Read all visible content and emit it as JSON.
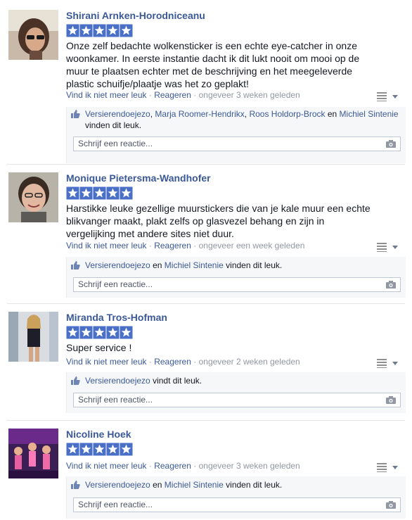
{
  "reviews": [
    {
      "name": "Shirani Arnken-Horodniceanu",
      "rating": 5,
      "text": "Onze zelf bedachte wolkensticker is een echte eye-catcher in onze woonkamer. In eerste instantie dacht ik dit lukt nooit om mooi op de muur te plaatsen echter met de beschrijving en het meegeleverde plastic schuifje/plaatje was het zo geplakt!",
      "unlike": "Vind ik niet meer leuk",
      "reply": "Reageren",
      "time": "ongeveer 3 weken geleden",
      "likers": [
        "Versierendoejezo",
        "Marja Roomer-Hendrikx",
        "Roos Holdorp-Brock",
        "Michiel Sintenie"
      ],
      "likes_suffix": "vinden dit leuk.",
      "comment_placeholder": "Schrijf een reactie..."
    },
    {
      "name": "Monique Pietersma-Wandhofer",
      "rating": 5,
      "text": "Harstikke leuke gezellige muurstickers die van je kale muur een echte blikvanger maakt, plakt zelfs op glasvezel behang en zijn in vergelijking met andere sites niet duur.",
      "unlike": "Vind ik niet meer leuk",
      "reply": "Reageren",
      "time": "ongeveer een week geleden",
      "likers": [
        "Versierendoejezo",
        "Michiel Sintenie"
      ],
      "likes_suffix": "vinden dit leuk.",
      "comment_placeholder": "Schrijf een reactie..."
    },
    {
      "name": "Miranda Tros-Hofman",
      "rating": 5,
      "text": "Super service !",
      "unlike": "Vind ik niet meer leuk",
      "reply": "Reageren",
      "time": "ongeveer 2 weken geleden",
      "likers": [
        "Versierendoejezo"
      ],
      "likes_suffix": "vindt dit leuk.",
      "comment_placeholder": "Schrijf een reactie..."
    },
    {
      "name": "Nicoline Hoek",
      "rating": 5,
      "text": "",
      "unlike": "Vind ik niet meer leuk",
      "reply": "Reageren",
      "time": "ongeveer 3 weken geleden",
      "likers": [
        "Versierendoejezo",
        "Michiel Sintenie"
      ],
      "likes_suffix": "vinden dit leuk.",
      "comment_placeholder": "Schrijf een reactie..."
    }
  ],
  "separator_dot": "·",
  "conjunction_and": "en",
  "colors": {
    "link": "#3b5998",
    "star": "#4a6fc7",
    "meta": "#9197a3"
  },
  "icons": {
    "star": "star-icon",
    "like": "like-thumb-icon",
    "menu": "menu-dropdown-icon",
    "camera": "camera-icon"
  }
}
